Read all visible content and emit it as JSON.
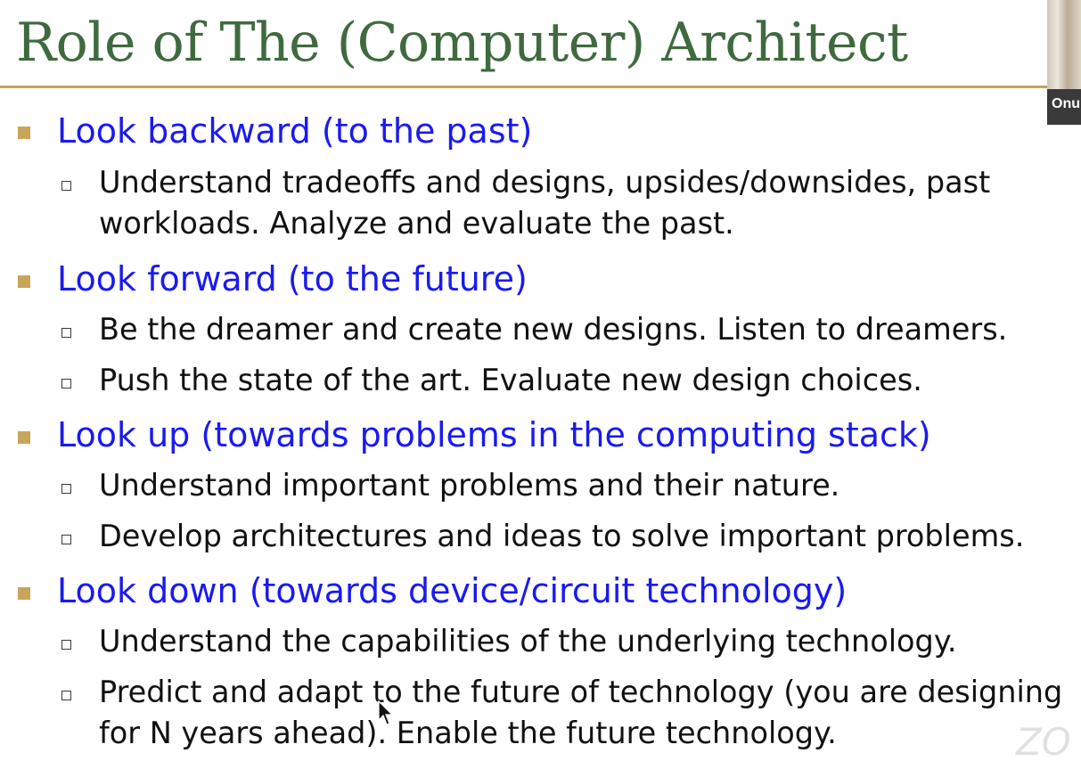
{
  "slide": {
    "title": "Role of The (Computer) Architect",
    "webcam_name": "Onu",
    "watermark": "ZO"
  },
  "colors": {
    "title": "#3f6a3f",
    "rule": "#c6a35e",
    "main_bullet": "#c9a45b",
    "main_text": "#1a1af0",
    "sub_text": "#111111"
  },
  "icons": {
    "main_bullet": "filled-square",
    "sub_bullet": "hollow-square",
    "pointer": "mouse-pointer-icon"
  },
  "items": [
    {
      "label": "Look backward (to the past)",
      "subs": [
        "Understand tradeoffs and designs, upsides/downsides, past workloads. Analyze and evaluate the past."
      ]
    },
    {
      "label": "Look forward (to the future)",
      "subs": [
        "Be the dreamer and create new designs. Listen to dreamers.",
        "Push the state of the art. Evaluate new design choices."
      ]
    },
    {
      "label": "Look up (towards problems in the computing stack)",
      "subs": [
        "Understand important problems and their nature.",
        "Develop architectures and ideas to solve important problems."
      ]
    },
    {
      "label": "Look down (towards device/circuit technology)",
      "subs": [
        "Understand the capabilities of the underlying technology.",
        "Predict and adapt to the future of technology (you are designing for N years ahead). Enable the future technology."
      ]
    }
  ]
}
